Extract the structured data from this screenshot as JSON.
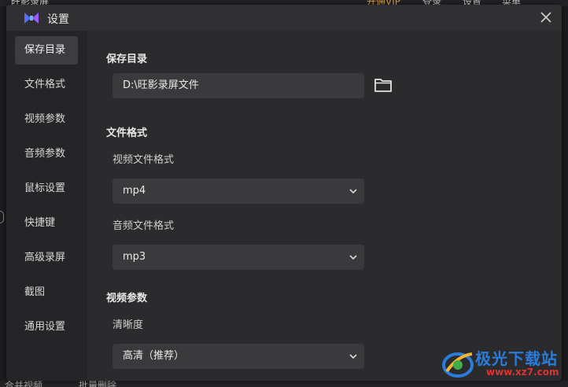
{
  "background_app": {
    "title": "旺影录屏",
    "menu": [
      "开通VIP",
      "登录",
      "设置",
      "菜单"
    ],
    "bottom_items": [
      "合并视频",
      "批量删除"
    ]
  },
  "dialog": {
    "title": "设置",
    "close_icon": "close-icon"
  },
  "sidebar": {
    "items": [
      {
        "label": "保存目录",
        "active": true
      },
      {
        "label": "文件格式"
      },
      {
        "label": "视频参数"
      },
      {
        "label": "音频参数"
      },
      {
        "label": "鼠标设置"
      },
      {
        "label": "快捷键"
      },
      {
        "label": "高级录屏"
      },
      {
        "label": "截图"
      },
      {
        "label": "通用设置"
      }
    ]
  },
  "save_dir": {
    "title": "保存目录",
    "path": "D:\\旺影录屏文件",
    "browse_icon": "folder-icon"
  },
  "file_format": {
    "title": "文件格式",
    "video_label": "视频文件格式",
    "video_value": "mp4",
    "audio_label": "音频文件格式",
    "audio_value": "mp3"
  },
  "video_params": {
    "title": "视频参数",
    "quality_label": "清晰度",
    "quality_value": "高清（推荐）"
  },
  "watermark": {
    "name": "极光下载站",
    "url": "www.xz7.com"
  },
  "colors": {
    "dialog_bg": "#2b2b2e",
    "sidebar_bg": "#252528",
    "field_bg": "#3a3a3d",
    "active_item_bg": "#3d3d41",
    "vip": "#e0a24a"
  }
}
